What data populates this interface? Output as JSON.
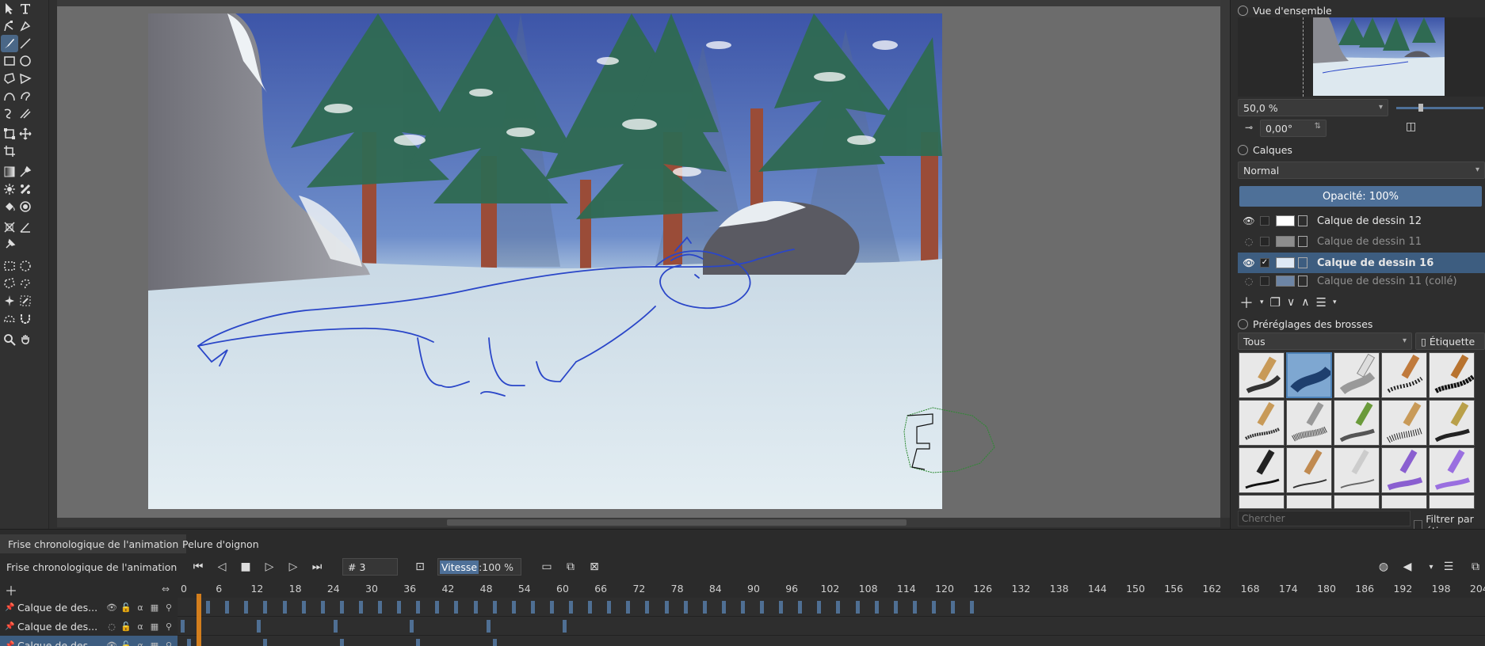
{
  "overview": {
    "title": "Vue d'ensemble",
    "zoom": "50,0 %",
    "rotation": "0,00°"
  },
  "layers": {
    "title": "Calques",
    "blend_mode": "Normal",
    "opacity_label": "Opacité:  100%",
    "items": [
      {
        "name": "Calque de dessin 12",
        "visible": true,
        "selected": false
      },
      {
        "name": "Calque de dessin 11",
        "visible": false,
        "selected": false
      },
      {
        "name": "Calque de dessin 16",
        "visible": true,
        "selected": true
      },
      {
        "name": "Calque de dessin 11 (collé)",
        "visible": false,
        "selected": false
      }
    ]
  },
  "brushes": {
    "title": "Préréglages des brosses",
    "filter": "Tous",
    "tag_label": "Étiquette",
    "search_placeholder": "Chercher",
    "filter_tag_label": "Filtrer par éti"
  },
  "timeline": {
    "tab_animation": "Frise chronologique de l'animation",
    "tab_onion": "Pelure d'oignon",
    "header_label": "Frise chronologique de l'animation",
    "frame_value": "# 3",
    "speed_label": "Vitesse",
    "speed_value": ":100 %",
    "ruler_ticks": [
      "0",
      "6",
      "12",
      "18",
      "24",
      "30",
      "36",
      "42",
      "48",
      "54",
      "60",
      "66",
      "72",
      "78",
      "84",
      "90",
      "96",
      "102",
      "108",
      "114",
      "120",
      "126",
      "132",
      "138",
      "144",
      "150",
      "156",
      "162",
      "168",
      "174",
      "180",
      "186",
      "192",
      "198",
      "204"
    ],
    "layers": [
      {
        "name": "Calque de des..."
      },
      {
        "name": "Calque de des..."
      },
      {
        "name": "Calque de des..."
      }
    ],
    "current_frame": 3
  },
  "colors": {
    "accent": "#4e7098",
    "selection": "#3d5d80",
    "playhead": "#f08c1a",
    "sketch": "#2a46c8"
  }
}
